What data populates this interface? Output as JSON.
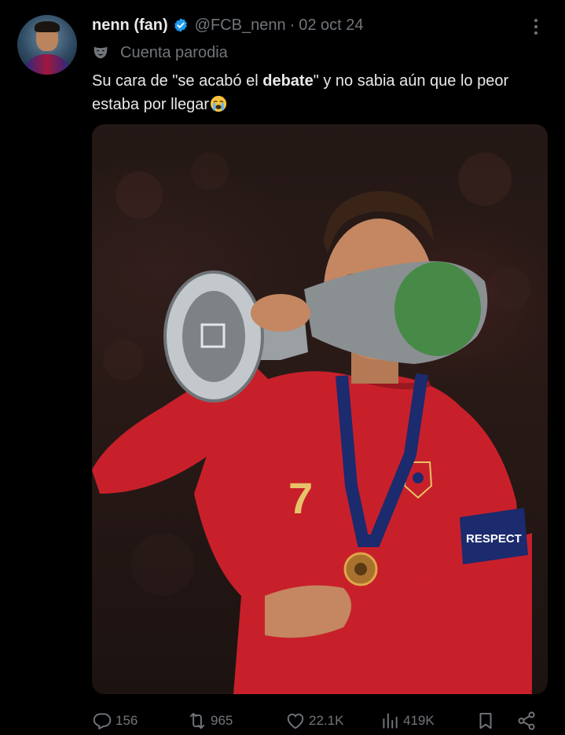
{
  "author": {
    "display_name": "nenn (fan)",
    "handle": "@FCB_nenn",
    "separator": "·",
    "date": "02 oct 24",
    "badge": "parody-mask-icon",
    "badge_label": "Cuenta parodia",
    "verified_color": "#1d9bf0"
  },
  "tweet": {
    "text_before": "Su cara de \"se acabó el ",
    "text_bold": "debate",
    "text_after": "\" y no sabia aún que lo peor estaba por llegar",
    "emoji": "crying-face-emoji"
  },
  "media": {
    "jersey_number": "7",
    "armband_text": "RESPECT"
  },
  "actions": {
    "replies": "156",
    "reposts": "965",
    "likes": "22.1K",
    "views": "419K"
  },
  "colors": {
    "background": "#000000",
    "text_primary": "#e7e9ea",
    "text_secondary": "#71767b"
  }
}
